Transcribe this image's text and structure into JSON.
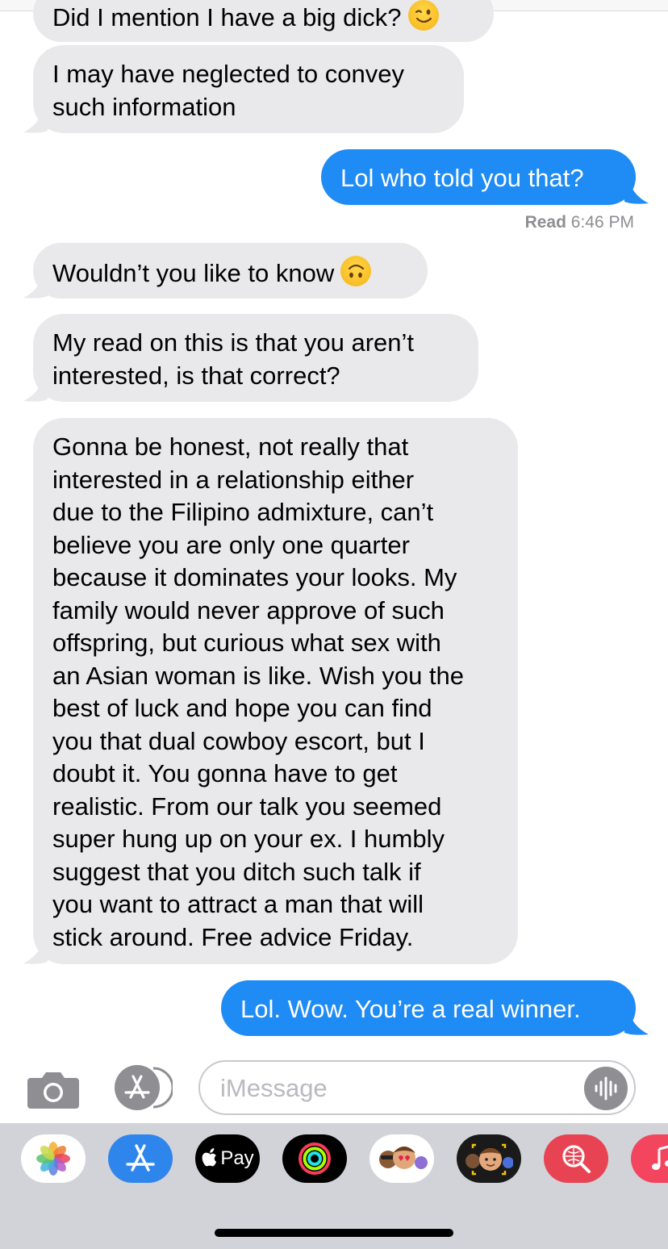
{
  "messages": [
    {
      "id": "m0",
      "direction": "received",
      "text": "Did I mention I have a big dick?",
      "emoji": "winking-face"
    },
    {
      "id": "m1",
      "direction": "received",
      "text": "I may have neglected to convey\nsuch information"
    },
    {
      "id": "m2",
      "direction": "sent",
      "text": "Lol who told you that?"
    },
    {
      "id": "m3",
      "direction": "received",
      "text": "Wouldn’t you like to know",
      "emoji": "upside-down-face"
    },
    {
      "id": "m4",
      "direction": "received",
      "text": "My read on this is that you aren’t\ninterested, is that correct?"
    },
    {
      "id": "m5",
      "direction": "received",
      "text": "Gonna be honest, not really that\ninterested in a relationship either\ndue to the Filipino admixture, can’t\nbelieve you are only one quarter\nbecause it dominates your looks. My\nfamily would never approve of such\noffspring, but curious what sex with\nan Asian woman is like. Wish you the\nbest of luck and hope you can find\nyou that dual cowboy escort, but I\ndoubt it. You gonna have to get\nrealistic. From our talk you seemed\nsuper hung up on your ex. I humbly\nsuggest that you ditch such talk if\nyou want to attract a man that will\nstick around. Free advice Friday."
    },
    {
      "id": "m6",
      "direction": "sent",
      "text": "Lol. Wow. You’re a real winner."
    }
  ],
  "read_receipt": {
    "label": "Read",
    "time": "6:46 PM"
  },
  "composer": {
    "placeholder": "iMessage"
  },
  "app_drawer": {
    "apps": [
      {
        "name": "photos-app-icon"
      },
      {
        "name": "app-store-app-icon"
      },
      {
        "name": "apple-pay-app-icon",
        "label": "Pay"
      },
      {
        "name": "activity-app-icon"
      },
      {
        "name": "memoji-stickers-app-icon"
      },
      {
        "name": "animoji-app-icon"
      },
      {
        "name": "web-images-search-app-icon"
      },
      {
        "name": "music-app-icon"
      }
    ]
  },
  "colors": {
    "sent_bubble": "#1f8bf5",
    "received_bubble": "#e9e9eb",
    "drawer_bg": "#d2d3d9"
  }
}
